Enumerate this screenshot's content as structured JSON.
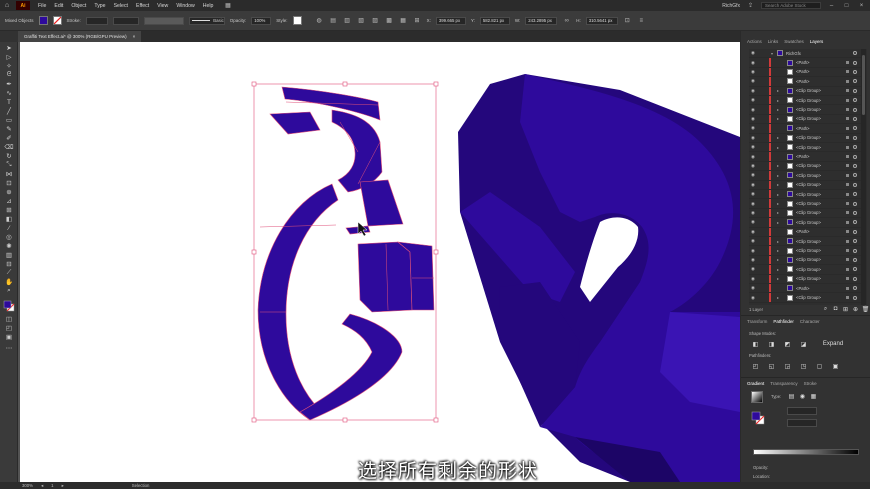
{
  "menubar": {
    "items": [
      "File",
      "Edit",
      "Object",
      "Type",
      "Select",
      "Effect",
      "View",
      "Window",
      "Help"
    ],
    "workspace": "RichGfx",
    "search_placeholder": "Search Adobe Stock"
  },
  "controlbar": {
    "selection_label": "Mixed Objects",
    "stroke_label": "Stroke:",
    "basic_label": "Basic",
    "opacity_label": "Opacity:",
    "opacity_value": "100%",
    "style_label": "Style:",
    "x_label": "X:",
    "x_value": "399.665 px",
    "y_label": "Y:",
    "y_value": "582.821 px",
    "w_label": "W:",
    "w_value": "243.2895 px",
    "h_label": "H:",
    "h_value": "310.5641 px"
  },
  "document_tab": {
    "title": "Graffiti Text Effect.ai* @ 300% (RGB/GPU Preview)",
    "close": "×"
  },
  "canvas": {
    "subtitle": "选择所有剩余的形状",
    "art_fill": "#2e0a9c",
    "art_shadow": "#24077c",
    "bbox_color": "#e0507a"
  },
  "statusbar": {
    "zoom": "300%",
    "artboard": "1",
    "mode": "Selection"
  },
  "right_panel": {
    "top_tabs": [
      "Actions",
      "Links",
      "Swatches",
      "Layers"
    ],
    "layer_root": "RichGfx",
    "layers": [
      {
        "name": "<Path>",
        "expand": false
      },
      {
        "name": "<Path>",
        "expand": false
      },
      {
        "name": "<Path>",
        "expand": false
      },
      {
        "name": "<Clip Group>",
        "expand": true
      },
      {
        "name": "<Clip Group>",
        "expand": true
      },
      {
        "name": "<Clip Group>",
        "expand": true
      },
      {
        "name": "<Clip Group>",
        "expand": true
      },
      {
        "name": "<Path>",
        "expand": false
      },
      {
        "name": "<Clip Group>",
        "expand": true
      },
      {
        "name": "<Clip Group>",
        "expand": true
      },
      {
        "name": "<Path>",
        "expand": false
      },
      {
        "name": "<Clip Group>",
        "expand": true
      },
      {
        "name": "<Clip Group>",
        "expand": true
      },
      {
        "name": "<Clip Group>",
        "expand": true
      },
      {
        "name": "<Clip Group>",
        "expand": true
      },
      {
        "name": "<Clip Group>",
        "expand": true
      },
      {
        "name": "<Clip Group>",
        "expand": true
      },
      {
        "name": "<Clip Group>",
        "expand": true
      },
      {
        "name": "<Path>",
        "expand": false
      },
      {
        "name": "<Clip Group>",
        "expand": true
      },
      {
        "name": "<Clip Group>",
        "expand": true
      },
      {
        "name": "<Clip Group>",
        "expand": true
      },
      {
        "name": "<Clip Group>",
        "expand": true
      },
      {
        "name": "<Clip Group>",
        "expand": true
      },
      {
        "name": "<Path>",
        "expand": false
      },
      {
        "name": "<Clip Group>",
        "expand": true
      }
    ],
    "layers_count": "1 Layer",
    "mid_tabs": [
      "Transform",
      "Pathfinder",
      "Character"
    ],
    "shape_modes_label": "Shape Modes:",
    "pathfinders_label": "Pathfinders:",
    "expand_label": "Expand",
    "bottom_tabs": [
      "Gradient",
      "Transparency",
      "Stroke"
    ],
    "type_label": "Type:",
    "stroke_label": "Stroke:",
    "opacity_label": "Opacity:",
    "location_label": "Location:"
  }
}
